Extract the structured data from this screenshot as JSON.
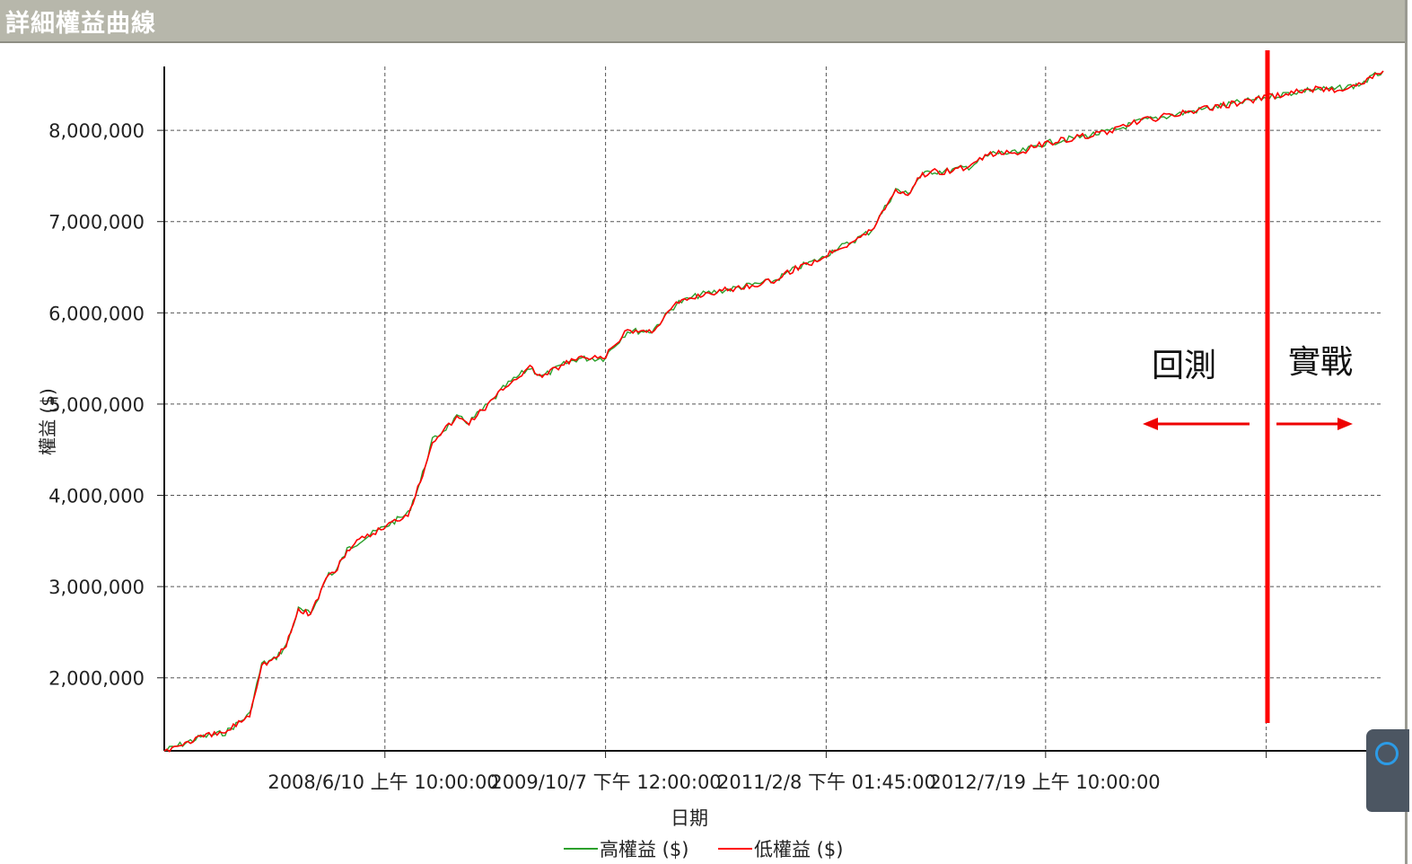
{
  "window": {
    "title": "詳細權益曲線"
  },
  "chart_data": {
    "type": "line",
    "ylabel": "權益 ($)",
    "xlabel": "日期",
    "yticks": [
      2000000,
      3000000,
      4000000,
      5000000,
      6000000,
      7000000,
      8000000
    ],
    "ytick_labels": [
      "2,000,000",
      "3,000,000",
      "4,000,000",
      "5,000,000",
      "6,000,000",
      "7,000,000",
      "8,000,000"
    ],
    "ylim": [
      1200000,
      8700000
    ],
    "xtick_labels": [
      "2008/6/10 上午 10:00:00",
      "2009/10/7 下午 12:00:00",
      "2011/2/8 下午 01:45:00",
      "2012/7/19 上午 10:00:00"
    ],
    "grid": true,
    "legend_position": "bottom",
    "series": [
      {
        "name": "高權益 ($)",
        "color": "#2ca02c",
        "x": [
          0,
          0.03,
          0.05,
          0.07,
          0.08,
          0.09,
          0.1,
          0.11,
          0.12,
          0.135,
          0.14,
          0.15,
          0.16,
          0.18,
          0.2,
          0.21,
          0.22,
          0.24,
          0.25,
          0.27,
          0.28,
          0.3,
          0.31,
          0.33,
          0.34,
          0.36,
          0.38,
          0.4,
          0.42,
          0.44,
          0.46,
          0.48,
          0.5,
          0.52,
          0.54,
          0.55,
          0.56,
          0.58,
          0.6,
          0.61,
          0.62,
          0.63,
          0.64,
          0.66,
          0.68,
          0.7,
          0.72,
          0.74,
          0.76,
          0.78,
          0.8,
          0.82,
          0.84,
          0.86,
          0.88,
          0.9,
          0.92,
          0.94,
          0.96,
          0.98,
          1.0
        ],
        "values": [
          1200000,
          1350000,
          1400000,
          1600000,
          2150000,
          2200000,
          2350000,
          2750000,
          2700000,
          3150000,
          3150000,
          3400000,
          3500000,
          3650000,
          3800000,
          4150000,
          4600000,
          4850000,
          4800000,
          5050000,
          5200000,
          5400000,
          5300000,
          5450000,
          5500000,
          5500000,
          5800000,
          5800000,
          6100000,
          6200000,
          6250000,
          6300000,
          6350000,
          6500000,
          6600000,
          6700000,
          6750000,
          6900000,
          7350000,
          7300000,
          7500000,
          7550000,
          7550000,
          7600000,
          7750000,
          7750000,
          7850000,
          7900000,
          7950000,
          8000000,
          8100000,
          8150000,
          8200000,
          8250000,
          8300000,
          8350000,
          8400000,
          8450000,
          8450000,
          8500000,
          8650000
        ]
      },
      {
        "name": "低權益 ($)",
        "color": "#ff0000",
        "x": [
          0,
          0.03,
          0.05,
          0.07,
          0.08,
          0.09,
          0.1,
          0.11,
          0.12,
          0.135,
          0.14,
          0.15,
          0.16,
          0.18,
          0.2,
          0.21,
          0.22,
          0.24,
          0.25,
          0.27,
          0.28,
          0.3,
          0.31,
          0.33,
          0.34,
          0.36,
          0.38,
          0.4,
          0.42,
          0.44,
          0.46,
          0.48,
          0.5,
          0.52,
          0.54,
          0.55,
          0.56,
          0.58,
          0.6,
          0.61,
          0.62,
          0.63,
          0.64,
          0.66,
          0.68,
          0.7,
          0.72,
          0.74,
          0.76,
          0.78,
          0.8,
          0.82,
          0.84,
          0.86,
          0.88,
          0.9,
          0.92,
          0.94,
          0.96,
          0.98,
          1.0
        ],
        "values": [
          1200000,
          1350000,
          1400000,
          1600000,
          2150000,
          2200000,
          2350000,
          2750000,
          2700000,
          3150000,
          3150000,
          3400000,
          3500000,
          3650000,
          3800000,
          4150000,
          4600000,
          4850000,
          4800000,
          5050000,
          5200000,
          5400000,
          5300000,
          5450000,
          5500000,
          5500000,
          5800000,
          5800000,
          6100000,
          6200000,
          6250000,
          6300000,
          6350000,
          6500000,
          6600000,
          6700000,
          6750000,
          6900000,
          7350000,
          7300000,
          7500000,
          7550000,
          7550000,
          7600000,
          7750000,
          7750000,
          7850000,
          7900000,
          7950000,
          8000000,
          8100000,
          8150000,
          8200000,
          8250000,
          8300000,
          8350000,
          8400000,
          8450000,
          8450000,
          8500000,
          8650000
        ]
      }
    ],
    "annotations": {
      "divider_x": 0.905,
      "divider_color": "#ff0000",
      "left_label": "回測",
      "right_label": "實戰"
    }
  }
}
